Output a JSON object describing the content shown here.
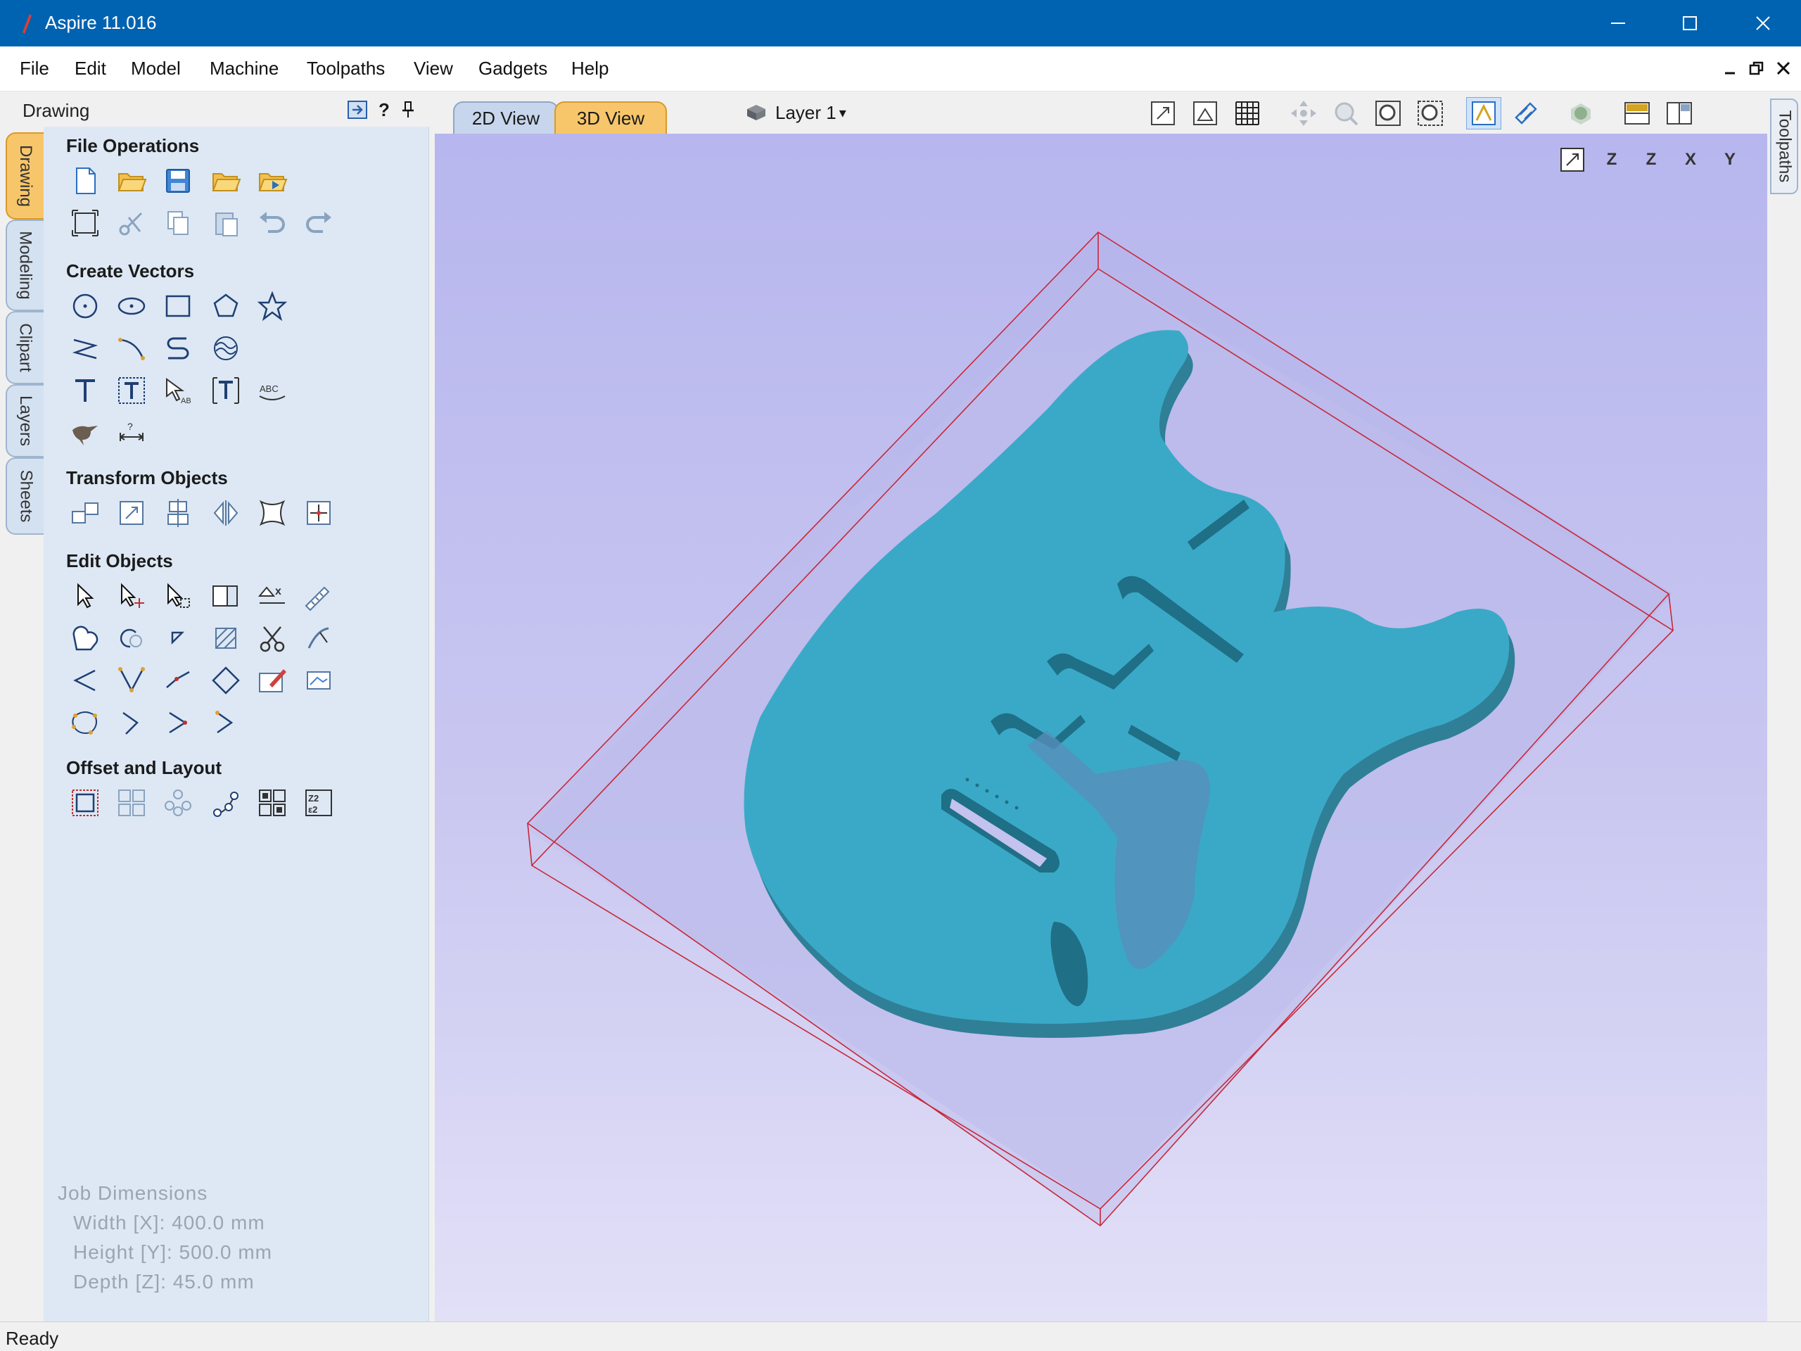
{
  "window": {
    "title": "Aspire 11.016"
  },
  "menu": [
    "File",
    "Edit",
    "Model",
    "Machine",
    "Toolpaths",
    "View",
    "Gadgets",
    "Help"
  ],
  "left_tabs": [
    "Drawing",
    "Modeling",
    "Clipart",
    "Layers",
    "Sheets"
  ],
  "right_tabs": [
    "Toolpaths"
  ],
  "drawing_panel": {
    "title": "Drawing",
    "help_label": "?",
    "sections": {
      "file_operations": "File Operations",
      "create_vectors": "Create Vectors",
      "transform_objects": "Transform Objects",
      "edit_objects": "Edit Objects",
      "offset_layout": "Offset and Layout"
    }
  },
  "view_tabs": {
    "tab_2d": "2D View",
    "tab_3d": "3D View",
    "active": "3D View"
  },
  "layer": {
    "label": "Layer 1",
    "arrow": "▾"
  },
  "axis_buttons": [
    "Z",
    "Z",
    "X",
    "Y"
  ],
  "job_dimensions": {
    "title": "Job Dimensions",
    "width": "Width  [X]: 400.0 mm",
    "height": "Height [Y]: 500.0 mm",
    "depth": "Depth  [Z]: 45.0 mm"
  },
  "status": {
    "text": "Ready"
  },
  "colors": {
    "title_bar": "#0063b1",
    "model": "#3aa9c7",
    "material_box": "#c8283a",
    "active_tab": "#f7c66a"
  }
}
